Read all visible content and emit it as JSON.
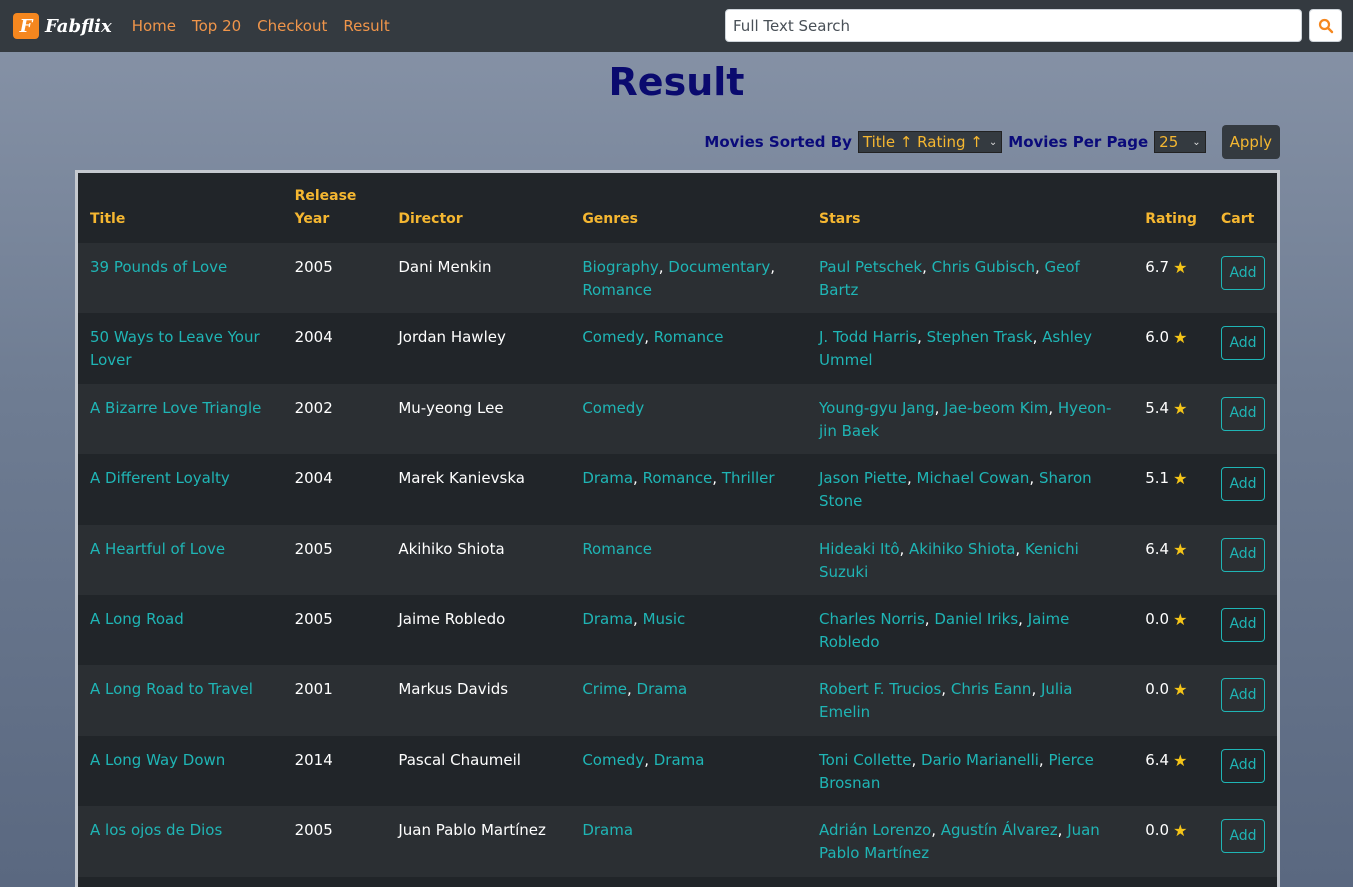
{
  "navbar": {
    "brand": "Fabflix",
    "brand_icon": "F",
    "links": [
      "Home",
      "Top 20",
      "Checkout",
      "Result"
    ],
    "search_placeholder": "Full Text Search"
  },
  "page_title": "Result",
  "controls": {
    "sort_label": "Movies Sorted By",
    "sort_value": "Title ↑ Rating ↑",
    "per_page_label": "Movies Per Page",
    "per_page_value": "25",
    "apply_label": "Apply"
  },
  "table": {
    "headers": [
      "Title",
      "Release Year",
      "Director",
      "Genres",
      "Stars",
      "Rating",
      "Cart"
    ],
    "add_label": "Add",
    "rows": [
      {
        "title": "39 Pounds of Love",
        "year": "2005",
        "director": "Dani Menkin",
        "genres": [
          "Biography",
          "Documentary",
          "Romance"
        ],
        "stars": [
          "Paul Petschek",
          "Chris Gubisch",
          "Geof Bartz"
        ],
        "rating": "6.7"
      },
      {
        "title": "50 Ways to Leave Your Lover",
        "year": "2004",
        "director": "Jordan Hawley",
        "genres": [
          "Comedy",
          "Romance"
        ],
        "stars": [
          "J. Todd Harris",
          "Stephen Trask",
          "Ashley Ummel"
        ],
        "rating": "6.0"
      },
      {
        "title": "A Bizarre Love Triangle",
        "year": "2002",
        "director": "Mu-yeong Lee",
        "genres": [
          "Comedy"
        ],
        "stars": [
          "Young-gyu Jang",
          "Jae-beom Kim",
          "Hyeon-jin Baek"
        ],
        "rating": "5.4"
      },
      {
        "title": "A Different Loyalty",
        "year": "2004",
        "director": "Marek Kanievska",
        "genres": [
          "Drama",
          "Romance",
          "Thriller"
        ],
        "stars": [
          "Jason Piette",
          "Michael Cowan",
          "Sharon Stone"
        ],
        "rating": "5.1"
      },
      {
        "title": "A Heartful of Love",
        "year": "2005",
        "director": "Akihiko Shiota",
        "genres": [
          "Romance"
        ],
        "stars": [
          "Hideaki Itô",
          "Akihiko Shiota",
          "Kenichi Suzuki"
        ],
        "rating": "6.4"
      },
      {
        "title": "A Long Road",
        "year": "2005",
        "director": "Jaime Robledo",
        "genres": [
          "Drama",
          "Music"
        ],
        "stars": [
          "Charles Norris",
          "Daniel Iriks",
          "Jaime Robledo"
        ],
        "rating": "0.0"
      },
      {
        "title": "A Long Road to Travel",
        "year": "2001",
        "director": "Markus Davids",
        "genres": [
          "Crime",
          "Drama"
        ],
        "stars": [
          "Robert F. Trucios",
          "Chris Eann",
          "Julia Emelin"
        ],
        "rating": "0.0"
      },
      {
        "title": "A Long Way Down",
        "year": "2014",
        "director": "Pascal Chaumeil",
        "genres": [
          "Comedy",
          "Drama"
        ],
        "stars": [
          "Toni Collette",
          "Dario Marianelli",
          "Pierce Brosnan"
        ],
        "rating": "6.4"
      },
      {
        "title": "A los ojos de Dios",
        "year": "2005",
        "director": "Juan Pablo Martínez",
        "genres": [
          "Drama"
        ],
        "stars": [
          "Adrián Lorenzo",
          "Agustín Álvarez",
          "Juan Pablo Martínez"
        ],
        "rating": "0.0"
      }
    ]
  },
  "colors": {
    "accent": "#f5b731",
    "link": "#1fb5b5",
    "nav_link": "#f0954a",
    "title": "#0a0a6e"
  }
}
